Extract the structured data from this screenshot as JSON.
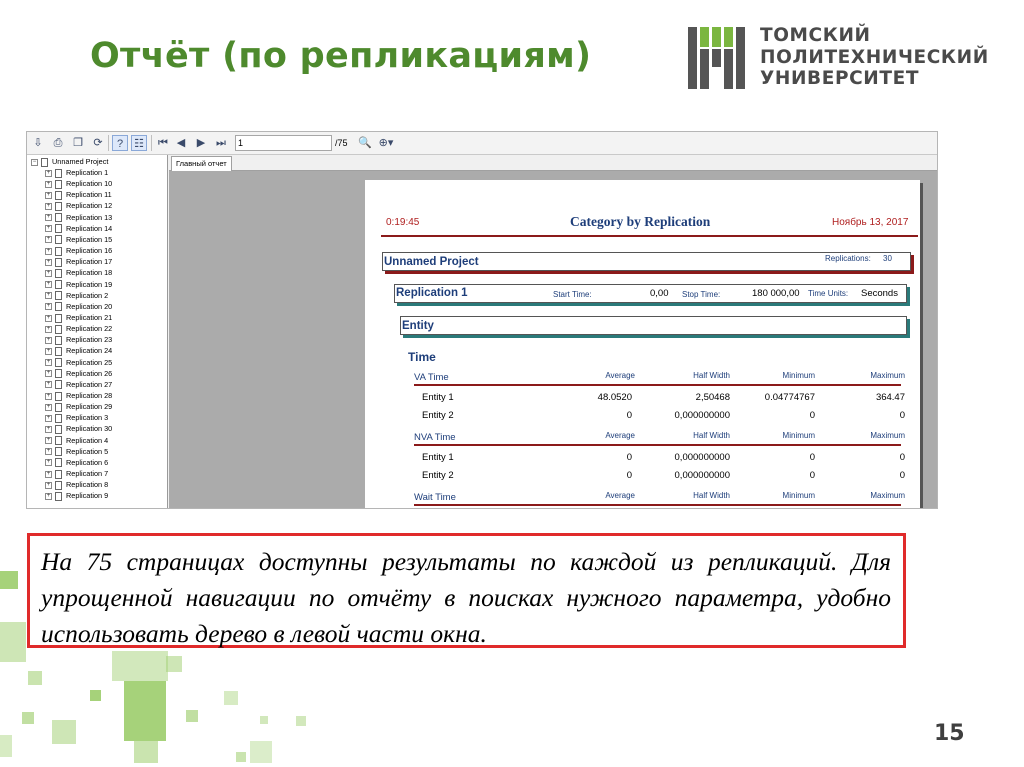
{
  "slide": {
    "title": "Отчёт (по репликациям)",
    "page_number": "15",
    "logo": {
      "line1": "ТОМСКИЙ",
      "line2": "ПОЛИТЕХНИЧЕСКИЙ",
      "line3": "УНИВЕРСИТЕТ"
    },
    "note": "На 75 страницах доступны результаты по каждой из репликаций. Для упрощенной навигации по отчёту в поисках нужного параметра, удобно использовать дерево в левой части окна."
  },
  "colors": {
    "title_green": "#4e8a2d",
    "note_border": "#e02a2a",
    "report_blue": "#1e3e7a",
    "report_red": "#b02020",
    "deco_green": "#a6d27a"
  },
  "toolbar": {
    "icons": [
      "export-icon",
      "print-icon",
      "copy-icon",
      "refresh-icon",
      "help-icon",
      "tree-toggle-icon",
      "first-page-icon",
      "prev-page-icon",
      "next-page-icon",
      "last-page-icon",
      "search-icon",
      "zoom-icon"
    ],
    "page_input": "1",
    "page_total": "/75"
  },
  "tree": {
    "root": "Unnamed Project",
    "items": [
      "Replication 1",
      "Replication 10",
      "Replication 11",
      "Replication 12",
      "Replication 13",
      "Replication 14",
      "Replication 15",
      "Replication 16",
      "Replication 17",
      "Replication 18",
      "Replication 19",
      "Replication 2",
      "Replication 20",
      "Replication 21",
      "Replication 22",
      "Replication 23",
      "Replication 24",
      "Replication 25",
      "Replication 26",
      "Replication 27",
      "Replication 28",
      "Replication 29",
      "Replication 3",
      "Replication 30",
      "Replication 4",
      "Replication 5",
      "Replication 6",
      "Replication 7",
      "Replication 8",
      "Replication 9"
    ]
  },
  "tabs": {
    "main": "Главный отчет"
  },
  "report": {
    "time": "0:19:45",
    "title": "Category by Replication",
    "date": "Ноябрь 13, 2017",
    "project": {
      "name": "Unnamed Project",
      "replications_label": "Replications:",
      "replications_value": "30"
    },
    "replication": {
      "name": "Replication 1",
      "start_label": "Start Time:",
      "start_value": "0,00",
      "stop_label": "Stop Time:",
      "stop_value": "180 000,00",
      "units_label": "Time Units:",
      "units_value": "Seconds"
    },
    "entity_label": "Entity",
    "time_section": "Time",
    "columns": [
      "Average",
      "Half Width",
      "Minimum",
      "Maximum"
    ],
    "groups": [
      {
        "name": "VA Time",
        "rows": [
          {
            "name": "Entity 1",
            "values": [
              "48.0520",
              "2,50468",
              "0.04774767",
              "364.47"
            ]
          },
          {
            "name": "Entity 2",
            "values": [
              "0",
              "0,000000000",
              "0",
              "0"
            ]
          }
        ]
      },
      {
        "name": "NVA Time",
        "rows": [
          {
            "name": "Entity 1",
            "values": [
              "0",
              "0,000000000",
              "0",
              "0"
            ]
          },
          {
            "name": "Entity 2",
            "values": [
              "0",
              "0,000000000",
              "0",
              "0"
            ]
          }
        ]
      },
      {
        "name": "Wait Time",
        "rows": []
      }
    ]
  }
}
